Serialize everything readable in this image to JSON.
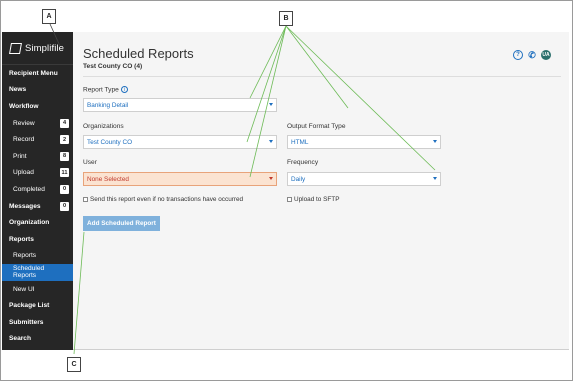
{
  "callouts": {
    "a": "A",
    "b": "B",
    "c": "C"
  },
  "brand": {
    "name": "Simplifile"
  },
  "sidebar": {
    "items": [
      {
        "label": "Recipient Menu",
        "sub": false
      },
      {
        "label": "News",
        "sub": false
      },
      {
        "label": "Workflow",
        "sub": false
      },
      {
        "label": "Review",
        "sub": true,
        "count": "4"
      },
      {
        "label": "Record",
        "sub": true,
        "count": "2"
      },
      {
        "label": "Print",
        "sub": true,
        "count": "8"
      },
      {
        "label": "Upload",
        "sub": true,
        "count": "11"
      },
      {
        "label": "Completed",
        "sub": true,
        "count": "0"
      },
      {
        "label": "Messages",
        "sub": false,
        "count": "0"
      },
      {
        "label": "Organization",
        "sub": false
      },
      {
        "label": "Reports",
        "sub": false
      },
      {
        "label": "Reports",
        "sub": true
      },
      {
        "label": "Scheduled Reports",
        "sub": true,
        "active": true
      },
      {
        "label": "New UI",
        "sub": true
      },
      {
        "label": "Package List",
        "sub": false
      },
      {
        "label": "Submitters",
        "sub": false
      },
      {
        "label": "Search",
        "sub": false
      }
    ]
  },
  "header": {
    "title": "Scheduled Reports",
    "subtitle": "Test County CO (4)",
    "help_icon": "?",
    "user_initials": "UA"
  },
  "form": {
    "report_type_label": "Report Type",
    "report_type_value": "Banking Detail",
    "organizations_label": "Organizations",
    "organizations_value": "Test County CO",
    "user_label": "User",
    "user_value": "None Selected",
    "output_format_label": "Output Format Type",
    "output_format_value": "HTML",
    "frequency_label": "Frequency",
    "frequency_value": "Daily",
    "send_checkbox_label": "Send this report even if no transactions have occurred",
    "sftp_checkbox_label": "Upload to SFTP",
    "add_button_label": "Add Scheduled Report"
  },
  "colors": {
    "accent": "#1e6fbf",
    "sidebar": "#262626",
    "active": "#1e6fbf",
    "warning_bg": "#fbe3d1"
  }
}
